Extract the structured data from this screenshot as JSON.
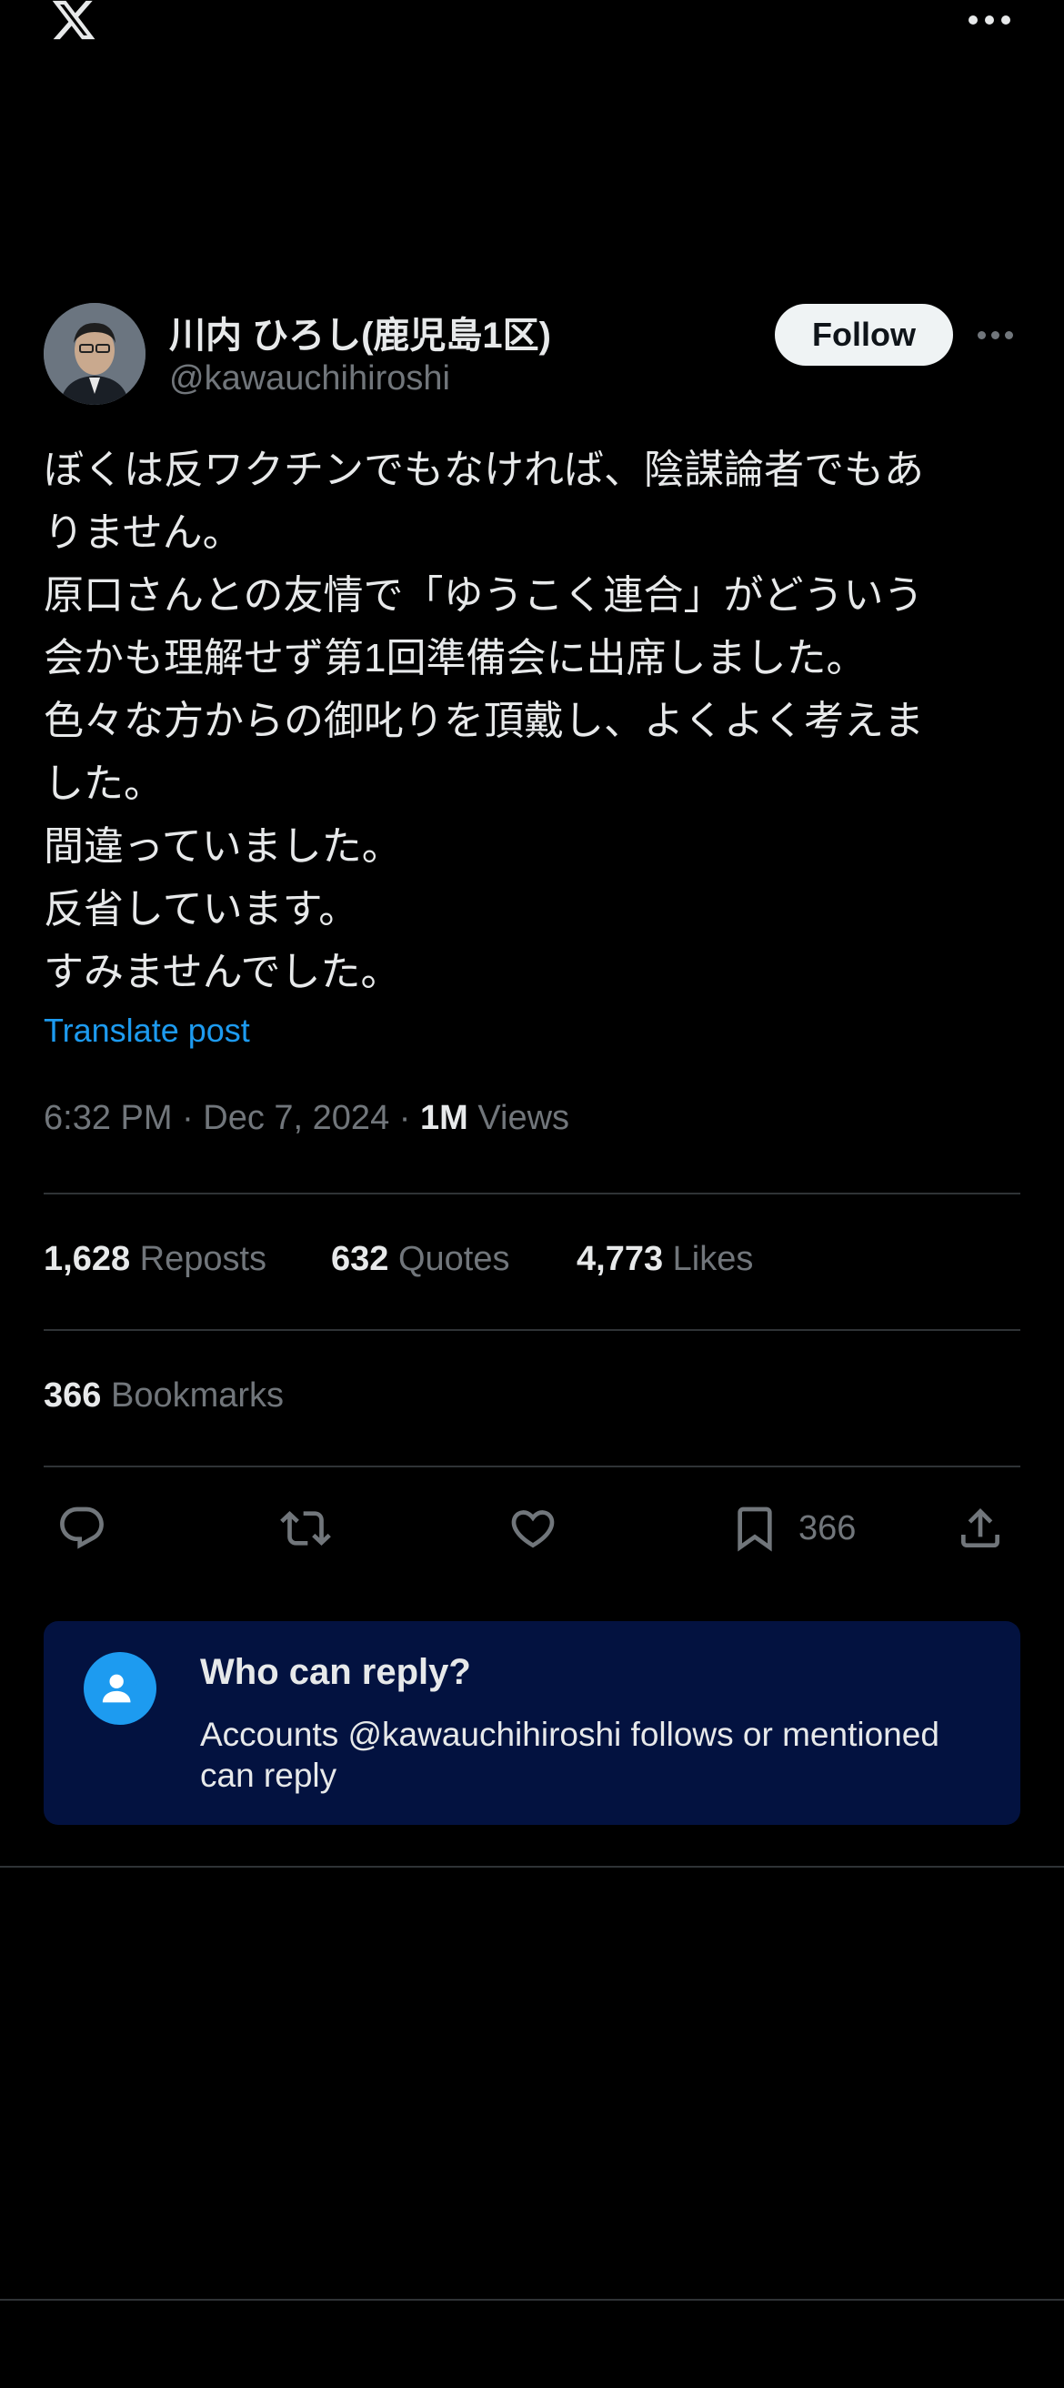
{
  "topbar": {
    "logo_icon": "x-logo-icon",
    "more_icon": "more-horizontal-icon"
  },
  "post": {
    "author_name": "川内 ひろし(鹿児島1区)",
    "author_handle": "@kawauchihiroshi",
    "follow_label": "Follow",
    "text_lines": [
      "ぼくは反ワクチンでもなければ、陰謀論者でもあ",
      "りません。",
      "原口さんとの友情で「ゆうこく連合」がどういう",
      "会かも理解せず第1回準備会に出席しました。",
      "色々な方からの御叱りを頂戴し、よくよく考えま",
      "した。",
      "間違っていました。",
      "反省しています。",
      "すみませんでした。"
    ],
    "translate_label": "Translate post",
    "timestamp": "6:32 PM · Dec 7, 2024 · ",
    "views_count": "1M",
    "views_label": "Views"
  },
  "stats": {
    "reposts_count": "1,628",
    "reposts_label": "Reposts",
    "quotes_count": "632",
    "quotes_label": "Quotes",
    "likes_count": "4,773",
    "likes_label": "Likes",
    "bookmarks_count": "366",
    "bookmarks_label": "Bookmarks"
  },
  "actions": {
    "bookmark_count": "366"
  },
  "reply_notice": {
    "title": "Who can reply?",
    "description": "Accounts @kawauchihiroshi follows or mentioned can reply"
  },
  "colors": {
    "background": "#000000",
    "text": "#e7e9ea",
    "muted": "#71767b",
    "accent": "#1d9bf0",
    "divider": "#2f3336",
    "notice_bg": "#031240"
  }
}
